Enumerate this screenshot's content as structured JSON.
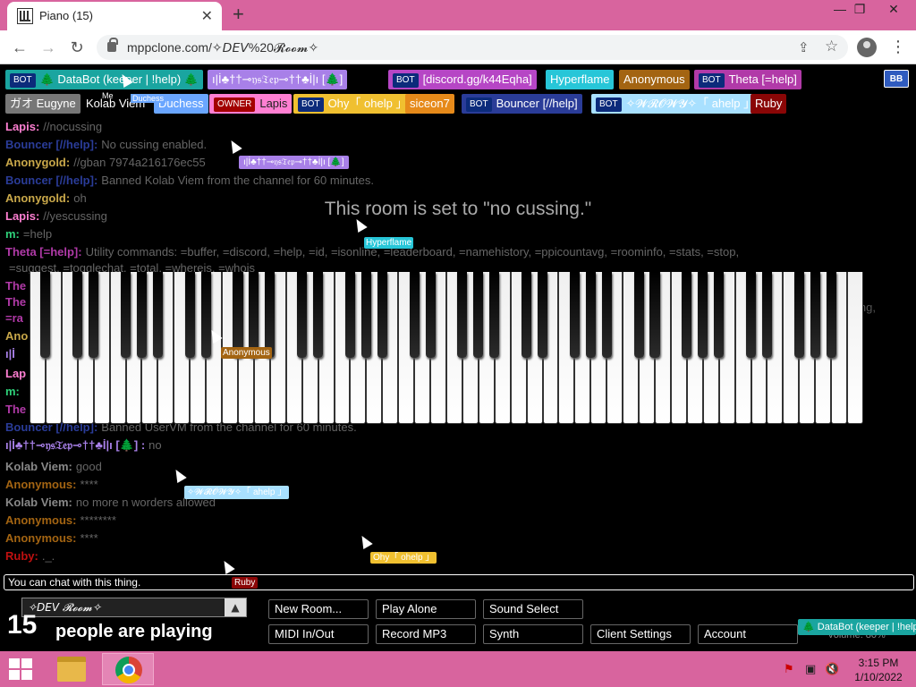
{
  "browser": {
    "tab_title": "Piano (15)",
    "tab_close": "✕",
    "new_tab": "+",
    "min": "—",
    "max": "❐",
    "close": "✕",
    "back": "←",
    "forward": "→",
    "reload": "↻",
    "url": "mppclone.com/✧𝘋𝘌𝘝%20𝓡𝓸𝓸𝓶✧",
    "share": "⇪",
    "star": "☆",
    "menu": "⋮"
  },
  "users": {
    "row1": [
      {
        "bot": "BOT",
        "name": "🌲 DataBot (keeper | !help) 🌲",
        "bg": "#1aa5a0",
        "color": "#fff"
      },
      {
        "name": "ı|İ♣††⊸𝔶𝔰𝔗𝔢𝔭⊸††♣İ|ı [🌲]",
        "bg": "#a880e8",
        "color": "#fff"
      },
      {
        "bot": "BOT",
        "name": "[discord.gg/k44Eqha]",
        "bg": "#b646c5",
        "color": "#fff"
      },
      {
        "name": "Hyperflame",
        "bg": "#27c6d8",
        "color": "#fff"
      },
      {
        "name": "Anonymous",
        "bg": "#a36412",
        "color": "#fff"
      },
      {
        "bot": "BOT",
        "name": "Theta [=help]",
        "bg": "#b13aa8",
        "color": "#fff"
      }
    ],
    "row2": [
      {
        "name": "ガオ Eugyne",
        "bg": "#777",
        "color": "#fff"
      },
      {
        "name": "Kolab Viem",
        "bg": "#000",
        "color": "#fff"
      },
      {
        "name": "Duchess",
        "bg": "#6aa6ff",
        "color": "#fff"
      },
      {
        "owner": "OWNER",
        "name": "Lapis",
        "bg": "#ff7fd2",
        "color": "#222"
      },
      {
        "bot": "BOT",
        "name": "Ohy「 ohelp 」",
        "bg": "#f0c030",
        "color": "#fff"
      },
      {
        "name": "siceon7",
        "bg": "#e68a1a",
        "color": "#fff"
      },
      {
        "bot": "BOT",
        "name": "Bouncer [//help]",
        "bg": "#2a3c98",
        "color": "#fff"
      },
      {
        "bot": "BOT",
        "name": "✧𝓦𝓡𝓞𝓦𝓨✧「 ahelp 」",
        "bg": "#a8e0ff",
        "color": "#fff"
      },
      {
        "name": "Ruby",
        "bg": "#8a0606",
        "color": "#fff"
      }
    ],
    "bb": "BB",
    "me_label": "Me",
    "duchess_tiny": "Duchess"
  },
  "chat": [
    {
      "name": "Lapis:",
      "color": "#ff7fd2",
      "msg": "//nocussing"
    },
    {
      "name": "Bouncer [//help]:",
      "color": "#2a3c98",
      "msg": "No cussing enabled."
    },
    {
      "name": "Anonygold:",
      "color": "#c9a84a",
      "msg": "//gban 7974a216176ec55"
    },
    {
      "name": "Bouncer [//help]:",
      "color": "#2a3c98",
      "msg": "Banned Kolab Viem from the channel for 60 minutes."
    },
    {
      "name": "Anonygold:",
      "color": "#c9a84a",
      "msg": "oh"
    },
    {
      "name": "Lapis:",
      "color": "#ff7fd2",
      "msg": "//yescussing"
    },
    {
      "name": "m:",
      "color": "#2fd27a",
      "msg": "=help"
    },
    {
      "name": "Theta [=help]:",
      "color": "#b13aa8",
      "msg": "Utility commands: =buffer, =discord, =help, =id, =isonline, =leaderboard, =namehistory, =ppicountavg, =roominfo, =stats, =stop,"
    },
    {
      "name": "",
      "color": "#b13aa8",
      "msg": "=suggest, =togglechat, =total, =whereis, =whois"
    },
    {
      "name": "The",
      "color": "#b13aa8",
      "msg": ""
    },
    {
      "name": "The",
      "color": "#b13aa8",
      "msg": ""
    },
    {
      "name": "=ra",
      "color": "#b13aa8",
      "msg": ""
    },
    {
      "name": "Ano",
      "color": "#c9a84a",
      "msg": ""
    },
    {
      "name": "ı|İ",
      "color": "#a880e8",
      "msg": ""
    },
    {
      "name": "Lap",
      "color": "#ff7fd2",
      "msg": ""
    },
    {
      "name": "m:",
      "color": "#2fd27a",
      "msg": ""
    },
    {
      "name": "The",
      "color": "#b13aa8",
      "msg": ""
    },
    {
      "name": "Bouncer [//help]:",
      "color": "#2a3c98",
      "msg": "Banned UserVM from the channel for 60 minutes."
    },
    {
      "name": "ı|İ♣††⊸𝔶𝔰𝔗𝔢𝔭⊸††♣İ|ı [🌲] :",
      "color": "#a880e8",
      "msg": "no"
    },
    {
      "name": "Kolab Viem:",
      "color": "#888",
      "msg": "good"
    },
    {
      "name": "Anonymous:",
      "color": "#a36412",
      "msg": "****"
    },
    {
      "name": "Kolab Viem:",
      "color": "#888",
      "msg": "no more n worders allowed"
    },
    {
      "name": "Anonymous:",
      "color": "#a36412",
      "msg": "********"
    },
    {
      "name": "Anonymous:",
      "color": "#a36412",
      "msg": "****"
    },
    {
      "name": "Ruby:",
      "color": "#c01010",
      "msg": "._."
    }
  ],
  "chat_extra": {
    "theta_tail": "ing,",
    "notice": "This room is set to \"no cussing.\""
  },
  "cursors": {
    "hyperflame": "Hyperflame",
    "anonymous": "Anonymous",
    "wrowy": "✧𝓦𝓡𝓞𝓦𝓨✧「 ahelp 」",
    "ohy": "Ohy「 ohelp 」",
    "ruby": "Ruby",
    "sysstep": "ı|İ♣††⊸𝔶𝔰𝔗𝔢𝔭⊸††♣İ|ı [🌲]",
    "databot": "🌲 DataBot (keeper | !help"
  },
  "chat_input": {
    "placeholder": "You can chat with this thing."
  },
  "bottom": {
    "room_name": "✧𝘋𝘌𝘝 𝓡𝓸𝓸𝓶✧",
    "room_arrow": "▲",
    "count": "15",
    "playing": "people are playing",
    "buttons": {
      "new_room": "New Room...",
      "play_alone": "Play Alone",
      "sound_select": "Sound Select",
      "midi": "MIDI In/Out",
      "record": "Record MP3",
      "synth": "Synth",
      "client_settings": "Client Settings",
      "account": "Account"
    },
    "volume": "Volume: 80%"
  },
  "taskbar": {
    "time": "3:15 PM",
    "date": "1/10/2022"
  }
}
